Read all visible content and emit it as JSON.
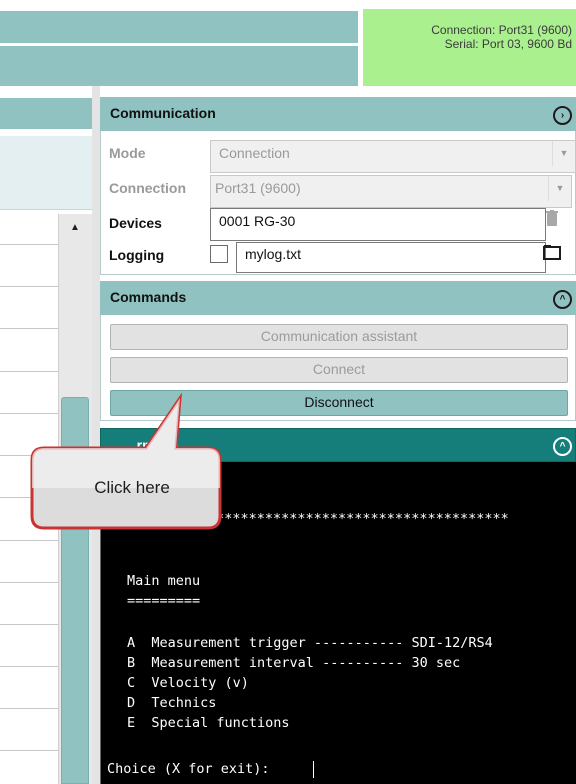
{
  "status": {
    "connection": "Connection: Port31 (9600)",
    "serial": "Serial: Port 03, 9600 Bd"
  },
  "communication": {
    "title": "Communication",
    "mode_label": "Mode",
    "mode_value": "Connection",
    "connection_label": "Connection",
    "connection_value": "Port31 (9600)",
    "devices_label": "Devices",
    "devices_value": "0001 RG-30",
    "logging_label": "Logging",
    "logging_file": "mylog.txt",
    "logging_checked": false
  },
  "commands": {
    "title": "Commands",
    "assistant_label": "Communication assistant",
    "connect_label": "Connect",
    "disconnect_label": "Disconnect"
  },
  "terminal": {
    "title_visible": "...rminal",
    "stars": "*************************************",
    "menu_title": "Main menu",
    "menu_underline": "=========",
    "items": [
      "A  Measurement trigger ----------- SDI-12/RS4",
      "B  Measurement interval ---------- 30 sec",
      "C  Velocity (v)",
      "D  Technics",
      "E  Special functions"
    ],
    "prompt": "Choice (X for exit): "
  },
  "callout": {
    "text": "Click here"
  },
  "icons": {
    "comm_collapse": "chevron-right-circle-icon",
    "cmd_collapse": "chevron-up-circle-icon",
    "term_collapse": "chevron-up-circle-icon",
    "device_delete": "trash-icon",
    "logging_browse": "folder-icon",
    "scroll_up": "triangle-up-icon"
  },
  "colors": {
    "panel_header": "#8fc2c1",
    "status_bg": "#aaf08f",
    "terminal_header": "#157e7a",
    "terminal_bg": "#000000"
  }
}
